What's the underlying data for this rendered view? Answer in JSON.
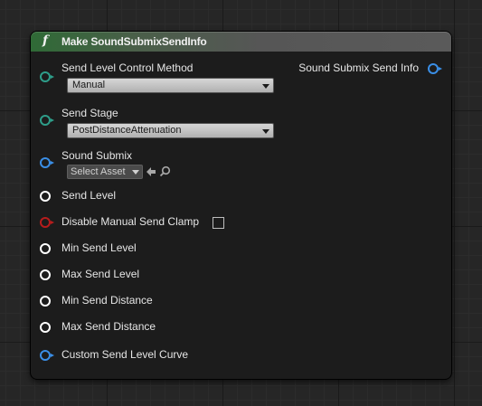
{
  "node": {
    "title": "Make SoundSubmixSendInfo",
    "function_icon": "f",
    "output": {
      "label": "Sound Submix Send Info",
      "pin_color": "#3a8ee6"
    },
    "inputs": [
      {
        "label": "Send Level Control Method",
        "pin": "teal",
        "widget": "dropdown",
        "value": "Manual"
      },
      {
        "label": "Send Stage",
        "pin": "teal",
        "widget": "dropdown",
        "value": "PostDistanceAttenuation"
      },
      {
        "label": "Sound Submix",
        "pin": "blue",
        "widget": "asset",
        "value": "Select Asset"
      },
      {
        "label": "Send Level",
        "pin": "white"
      },
      {
        "label": "Disable Manual Send Clamp",
        "pin": "red",
        "widget": "checkbox",
        "checked": false
      },
      {
        "label": "Min Send Level",
        "pin": "white"
      },
      {
        "label": "Max Send Level",
        "pin": "white"
      },
      {
        "label": "Min Send Distance",
        "pin": "white"
      },
      {
        "label": "Max Send Distance",
        "pin": "white"
      },
      {
        "label": "Custom Send Level Curve",
        "pin": "blue"
      }
    ]
  },
  "colors": {
    "teal": "#2e9e8a",
    "blue": "#3a8ee6",
    "red": "#b71c1c",
    "white": "#ffffff"
  },
  "icons": {
    "asset_use": "left-arrow-icon",
    "asset_browse": "search-icon"
  }
}
